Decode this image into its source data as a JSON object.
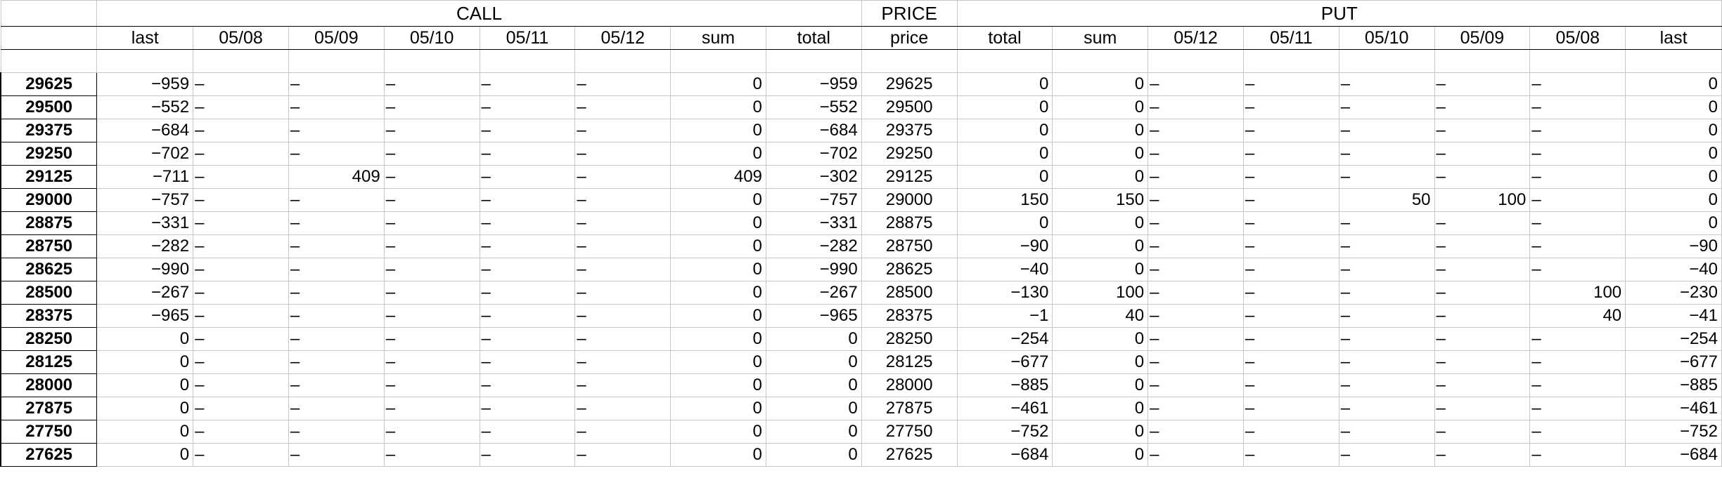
{
  "sections": {
    "call": "CALL",
    "price": "PRICE",
    "put": "PUT"
  },
  "columns": {
    "call": [
      "last",
      "05/08",
      "05/09",
      "05/10",
      "05/11",
      "05/12",
      "sum",
      "total"
    ],
    "price": "price",
    "put": [
      "total",
      "sum",
      "05/12",
      "05/11",
      "05/10",
      "05/09",
      "05/08",
      "last"
    ]
  },
  "dash": "–",
  "rows": [
    {
      "strike": "29625",
      "call": [
        "-959",
        "–",
        "–",
        "–",
        "–",
        "–",
        "0",
        "-959"
      ],
      "price": "29625",
      "put": [
        "0",
        "0",
        "–",
        "–",
        "–",
        "–",
        "–",
        "0"
      ]
    },
    {
      "strike": "29500",
      "call": [
        "-552",
        "–",
        "–",
        "–",
        "–",
        "–",
        "0",
        "-552"
      ],
      "price": "29500",
      "put": [
        "0",
        "0",
        "–",
        "–",
        "–",
        "–",
        "–",
        "0"
      ]
    },
    {
      "strike": "29375",
      "call": [
        "-684",
        "–",
        "–",
        "–",
        "–",
        "–",
        "0",
        "-684"
      ],
      "price": "29375",
      "put": [
        "0",
        "0",
        "–",
        "–",
        "–",
        "–",
        "–",
        "0"
      ]
    },
    {
      "strike": "29250",
      "call": [
        "-702",
        "–",
        "–",
        "–",
        "–",
        "–",
        "0",
        "-702"
      ],
      "price": "29250",
      "put": [
        "0",
        "0",
        "–",
        "–",
        "–",
        "–",
        "–",
        "0"
      ]
    },
    {
      "strike": "29125",
      "call": [
        "-711",
        "–",
        "409",
        "–",
        "–",
        "–",
        "409",
        "-302"
      ],
      "price": "29125",
      "put": [
        "0",
        "0",
        "–",
        "–",
        "–",
        "–",
        "–",
        "0"
      ]
    },
    {
      "strike": "29000",
      "call": [
        "-757",
        "–",
        "–",
        "–",
        "–",
        "–",
        "0",
        "-757"
      ],
      "price": "29000",
      "put": [
        "150",
        "150",
        "–",
        "–",
        "50",
        "100",
        "–",
        "0"
      ]
    },
    {
      "strike": "28875",
      "call": [
        "-331",
        "–",
        "–",
        "–",
        "–",
        "–",
        "0",
        "-331"
      ],
      "price": "28875",
      "put": [
        "0",
        "0",
        "–",
        "–",
        "–",
        "–",
        "–",
        "0"
      ]
    },
    {
      "strike": "28750",
      "call": [
        "-282",
        "–",
        "–",
        "–",
        "–",
        "–",
        "0",
        "-282"
      ],
      "price": "28750",
      "put": [
        "-90",
        "0",
        "–",
        "–",
        "–",
        "–",
        "–",
        "-90"
      ]
    },
    {
      "strike": "28625",
      "call": [
        "-990",
        "–",
        "–",
        "–",
        "–",
        "–",
        "0",
        "-990"
      ],
      "price": "28625",
      "put": [
        "-40",
        "0",
        "–",
        "–",
        "–",
        "–",
        "–",
        "-40"
      ]
    },
    {
      "strike": "28500",
      "call": [
        "-267",
        "–",
        "–",
        "–",
        "–",
        "–",
        "0",
        "-267"
      ],
      "price": "28500",
      "put": [
        "-130",
        "100",
        "–",
        "–",
        "–",
        "–",
        "100",
        "-230"
      ]
    },
    {
      "strike": "28375",
      "call": [
        "-965",
        "–",
        "–",
        "–",
        "–",
        "–",
        "0",
        "-965"
      ],
      "price": "28375",
      "put": [
        "-1",
        "40",
        "–",
        "–",
        "–",
        "–",
        "40",
        "-41"
      ]
    },
    {
      "strike": "28250",
      "call": [
        "0",
        "–",
        "–",
        "–",
        "–",
        "–",
        "0",
        "0"
      ],
      "price": "28250",
      "put": [
        "-254",
        "0",
        "–",
        "–",
        "–",
        "–",
        "–",
        "-254"
      ]
    },
    {
      "strike": "28125",
      "call": [
        "0",
        "–",
        "–",
        "–",
        "–",
        "–",
        "0",
        "0"
      ],
      "price": "28125",
      "put": [
        "-677",
        "0",
        "–",
        "–",
        "–",
        "–",
        "–",
        "-677"
      ]
    },
    {
      "strike": "28000",
      "call": [
        "0",
        "–",
        "–",
        "–",
        "–",
        "–",
        "0",
        "0"
      ],
      "price": "28000",
      "put": [
        "-885",
        "0",
        "–",
        "–",
        "–",
        "–",
        "–",
        "-885"
      ]
    },
    {
      "strike": "27875",
      "call": [
        "0",
        "–",
        "–",
        "–",
        "–",
        "–",
        "0",
        "0"
      ],
      "price": "27875",
      "put": [
        "-461",
        "0",
        "–",
        "–",
        "–",
        "–",
        "–",
        "-461"
      ]
    },
    {
      "strike": "27750",
      "call": [
        "0",
        "–",
        "–",
        "–",
        "–",
        "–",
        "0",
        "0"
      ],
      "price": "27750",
      "put": [
        "-752",
        "0",
        "–",
        "–",
        "–",
        "–",
        "–",
        "-752"
      ]
    },
    {
      "strike": "27625",
      "call": [
        "0",
        "–",
        "–",
        "–",
        "–",
        "–",
        "0",
        "0"
      ],
      "price": "27625",
      "put": [
        "-684",
        "0",
        "–",
        "–",
        "–",
        "–",
        "–",
        "-684"
      ]
    }
  ]
}
